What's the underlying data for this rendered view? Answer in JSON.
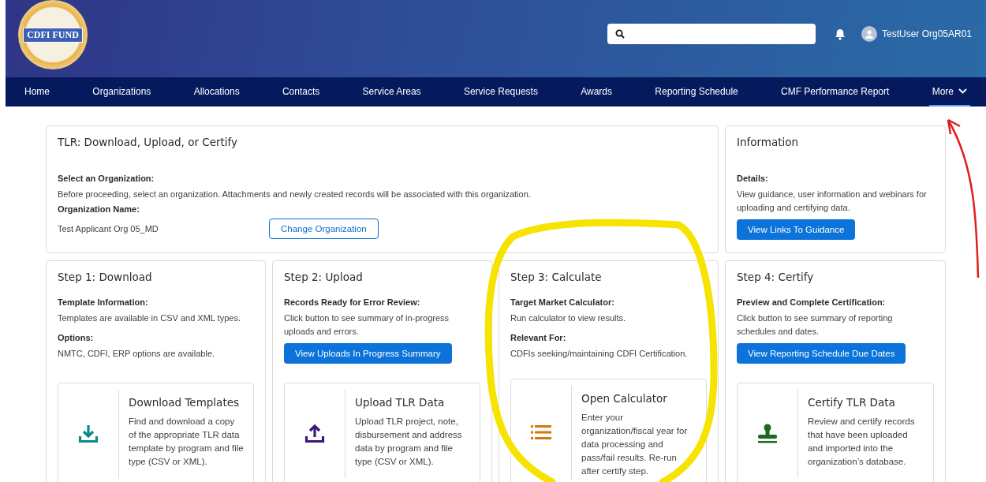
{
  "header": {
    "logo_text": "CDFI FUND",
    "user_name": "TestUser Org05AR01"
  },
  "nav": [
    {
      "label": "Home",
      "selected": false
    },
    {
      "label": "Organizations",
      "selected": false
    },
    {
      "label": "Allocations",
      "selected": false
    },
    {
      "label": "Contacts",
      "selected": false
    },
    {
      "label": "Service Areas",
      "selected": false
    },
    {
      "label": "Service Requests",
      "selected": false
    },
    {
      "label": "Awards",
      "selected": false
    },
    {
      "label": "Reporting Schedule",
      "selected": false
    },
    {
      "label": "CMF Performance Report",
      "selected": false
    },
    {
      "label": "More",
      "selected": true
    }
  ],
  "org_card": {
    "title": "TLR: Download, Upload, or Certify",
    "select_label": "Select an Organization:",
    "select_text": "Before proceeding, select an organization. Attachments and newly created records will be associated with this organization.",
    "name_label": "Organization Name:",
    "name_value": "Test Applicant Org 05_MD",
    "button": "Change Organization"
  },
  "info_card": {
    "title": "Information",
    "details_label": "Details:",
    "details_text": "View guidance, user information and webinars for uploading and certifying data.",
    "button": "View Links To Guidance"
  },
  "steps": [
    {
      "title": "Step 1: Download",
      "blocks": [
        {
          "kind": "label",
          "text": "Template Information:"
        },
        {
          "kind": "text",
          "text": "Templates are available in CSV and XML types."
        },
        {
          "kind": "label",
          "text": "Options:"
        },
        {
          "kind": "text",
          "text": "NMTC, CDFI, ERP options are available."
        }
      ],
      "tile": {
        "kind": "download",
        "title": "Download Templates",
        "text": "Find and download a copy of the appropriate TLR data template by program and file type (CSV or XML)."
      }
    },
    {
      "title": "Step 2: Upload",
      "blocks": [
        {
          "kind": "label",
          "text": "Records Ready for Error Review:"
        },
        {
          "kind": "text",
          "text": "Click button to see summary of in-progress uploads and errors."
        },
        {
          "kind": "button",
          "text": "View Uploads In Progress Summary"
        }
      ],
      "tile": {
        "kind": "upload",
        "title": "Upload TLR Data",
        "text": "Upload TLR project, note, disbursement and address data by program and file type (CSV or XML)."
      }
    },
    {
      "title": "Step 3: Calculate",
      "blocks": [
        {
          "kind": "label",
          "text": "Target Market Calculator:"
        },
        {
          "kind": "text",
          "text": "Run calculator to view results."
        },
        {
          "kind": "label",
          "text": "Relevant For:"
        },
        {
          "kind": "text",
          "text": "CDFIs seeking/maintaining CDFI Certification."
        }
      ],
      "tile": {
        "kind": "list",
        "title": "Open Calculator",
        "text": "Enter your organization/fiscal year for data processing and pass/fail results. Re-run after certify step."
      }
    },
    {
      "title": "Step 4: Certify",
      "blocks": [
        {
          "kind": "label",
          "text": "Preview and Complete Certification:"
        },
        {
          "kind": "text",
          "text": "Click button to see summary of reporting schedules and dates."
        },
        {
          "kind": "button",
          "text": "View Reporting Schedule Due Dates"
        }
      ],
      "tile": {
        "kind": "stamp",
        "title": "Certify TLR Data",
        "text": "Review and certify records that have been uploaded and imported into the organization’s database."
      }
    }
  ]
}
